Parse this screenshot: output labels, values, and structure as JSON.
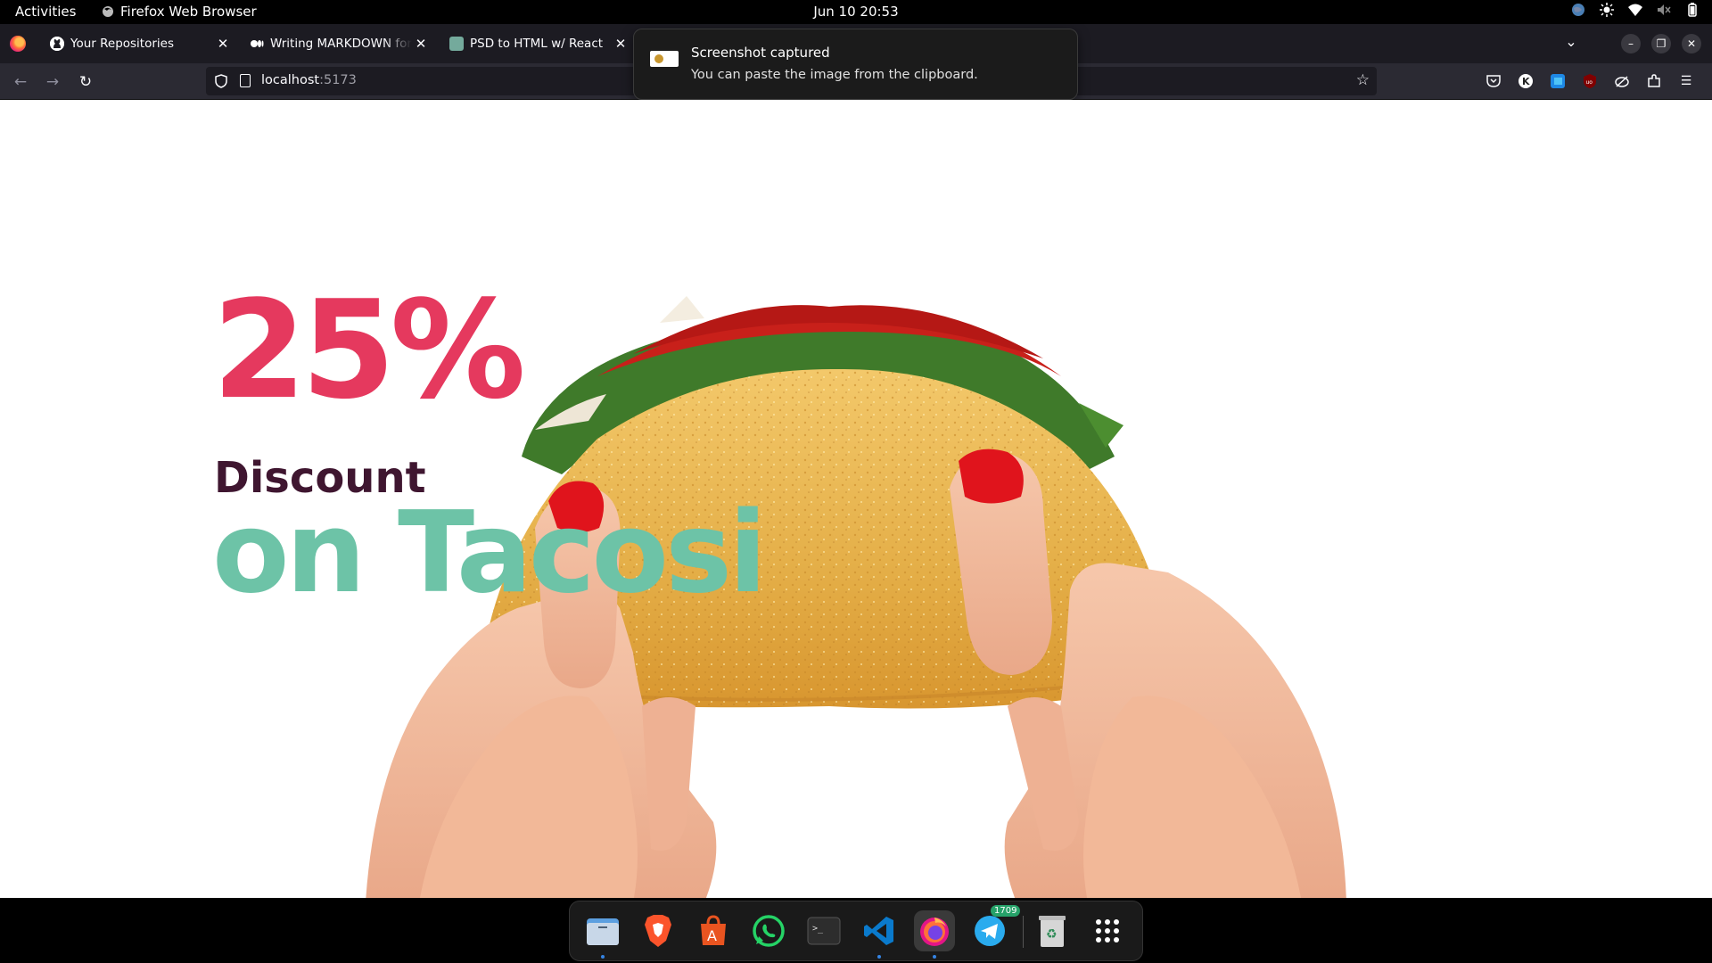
{
  "topbar": {
    "activities": "Activities",
    "app_name": "Firefox Web Browser",
    "clock": "Jun 10  20:53"
  },
  "browser": {
    "tabs": [
      {
        "title": "Your Repositories",
        "icon": "github-icon"
      },
      {
        "title": "Writing MARKDOWN for your",
        "icon": "medium-icon"
      },
      {
        "title": "PSD to HTML w/ React",
        "icon": "chatgpt-icon"
      }
    ],
    "url_host": "localhost",
    "url_port": ":5173"
  },
  "notification": {
    "title": "Screenshot captured",
    "body": "You can paste the image from the clipboard."
  },
  "hero": {
    "percent": "25%",
    "discount": "Discount",
    "tagline": "on Tacosi"
  },
  "dock": {
    "apps": [
      "Files",
      "Brave",
      "App Center",
      "WhatsApp",
      "Terminal",
      "Visual Studio Code",
      "Firefox",
      "Telegram",
      "Trash",
      "Show Apps"
    ],
    "telegram_badge": "1709"
  },
  "colors": {
    "percent": "#e5395e",
    "discount": "#3f1630",
    "tagline": "#6dc3a7",
    "taco_shell": "#e6b34c",
    "skin": "#f0b89a",
    "nail": "#e0141c"
  }
}
